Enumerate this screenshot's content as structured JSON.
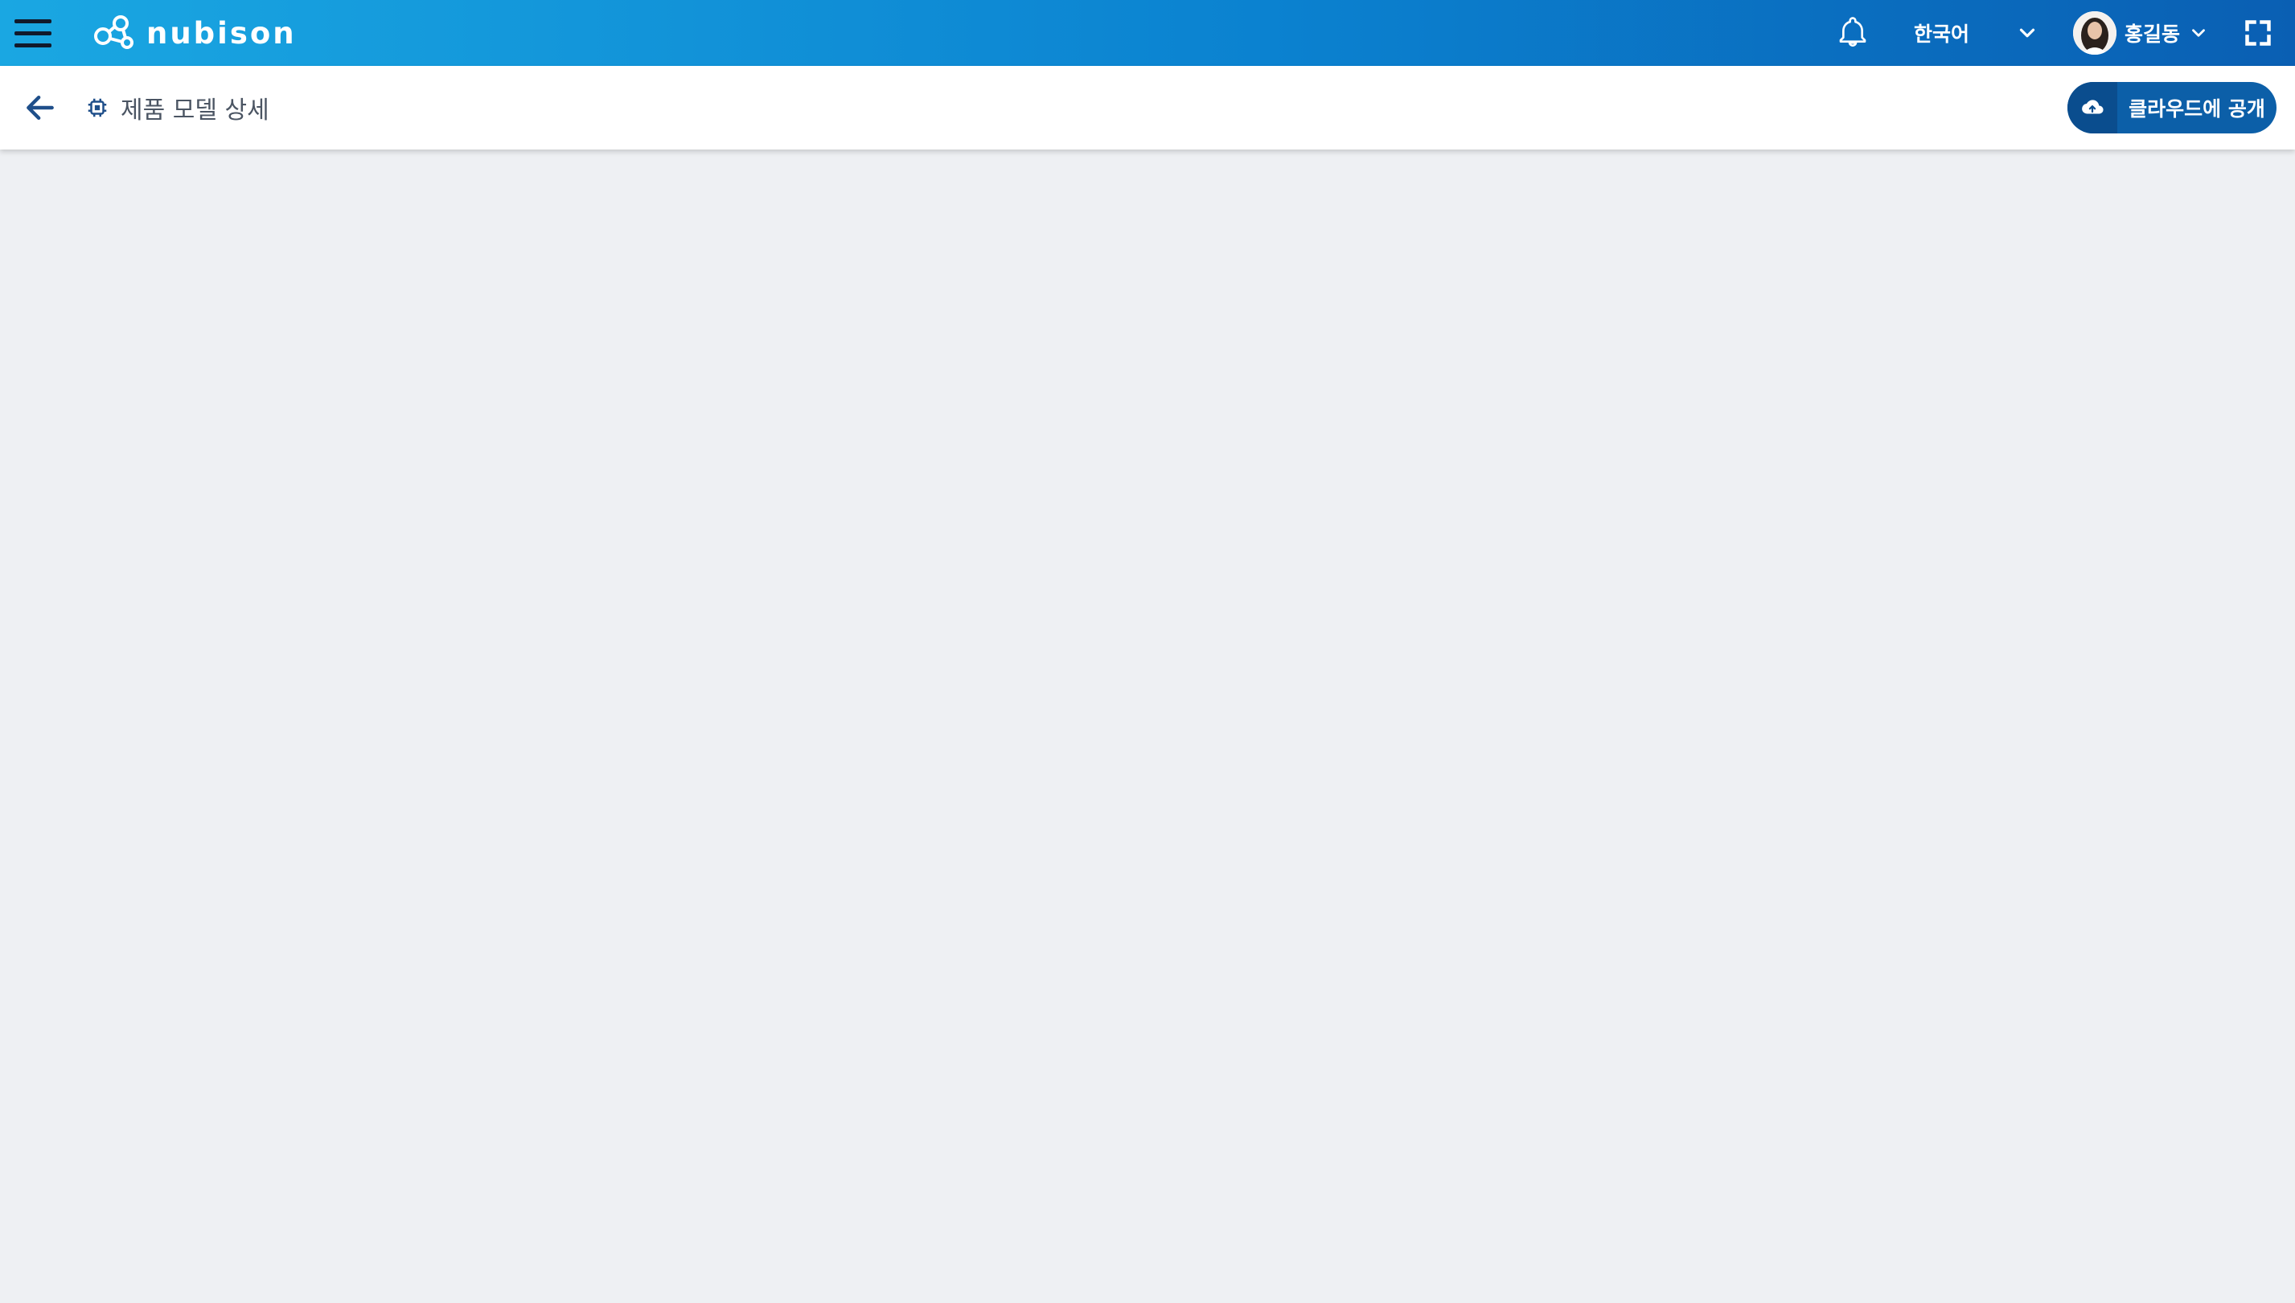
{
  "app": {
    "brand": "nubison",
    "language": "한국어",
    "user_name": "홍길동"
  },
  "header": {
    "page_title": "제품 모델 상세",
    "publish_label": "클라우드에 공개"
  },
  "colors": {
    "appbar_gradient": [
      "#1aa7e2",
      "#0b82d0",
      "#0a5fb3"
    ],
    "primary": "#0c5fa8"
  }
}
